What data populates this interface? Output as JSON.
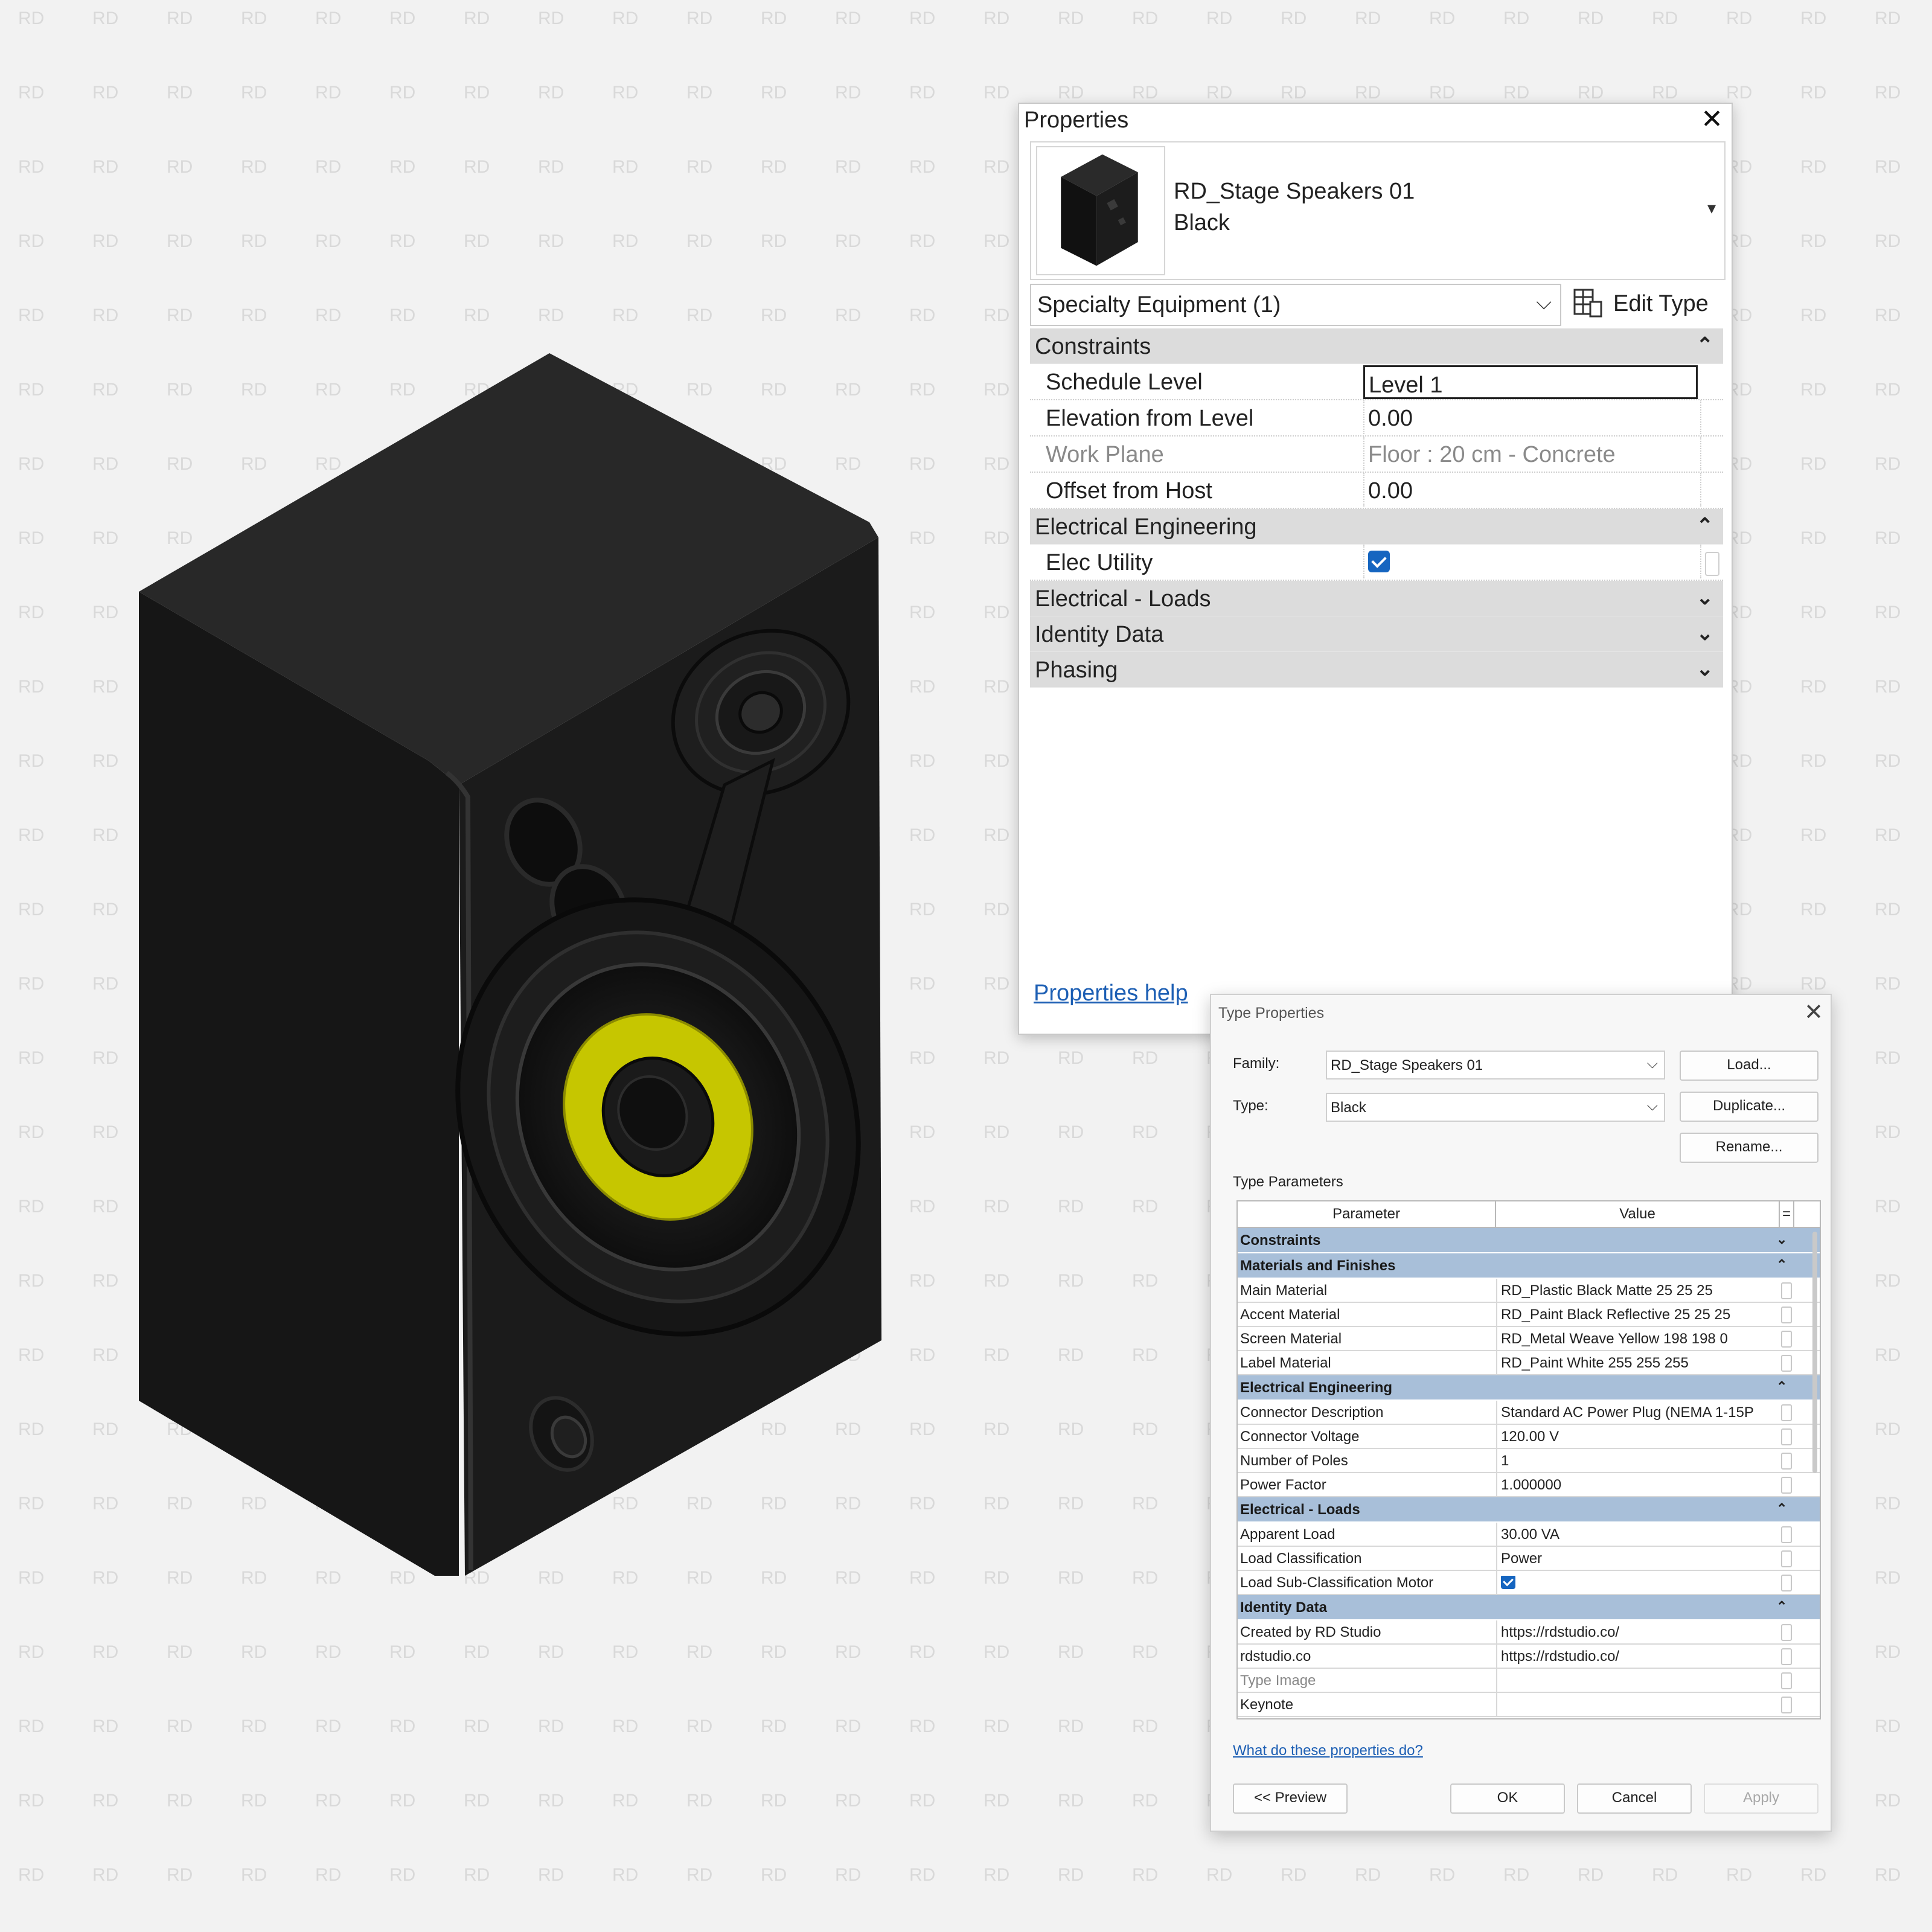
{
  "watermark": {
    "text": "RD",
    "color": "#d9d9d9"
  },
  "properties": {
    "title": "Properties",
    "close_glyph": "✕",
    "type_selector": {
      "family": "RD_Stage Speakers 01",
      "type": "Black",
      "arrow_glyph": "▾"
    },
    "category_dropdown": "Specialty Equipment (1)",
    "edit_type_label": "Edit Type",
    "groups": [
      {
        "label": "Constraints",
        "expanded": true,
        "rows": [
          {
            "name": "Schedule Level",
            "value": "Level 1",
            "editing": true
          },
          {
            "name": "Elevation from Level",
            "value": "0.00"
          },
          {
            "name": "Work Plane",
            "value": "Floor : 20 cm - Concrete",
            "readonly": true
          },
          {
            "name": "Offset from Host",
            "value": "0.00"
          }
        ]
      },
      {
        "label": "Electrical Engineering",
        "expanded": true,
        "rows": [
          {
            "name": "Elec Utility",
            "checked": true
          }
        ]
      },
      {
        "label": "Electrical - Loads",
        "expanded": false
      },
      {
        "label": "Identity Data",
        "expanded": false
      },
      {
        "label": "Phasing",
        "expanded": false
      }
    ],
    "help_link": "Properties help",
    "glyphs": {
      "collapse": "⌃",
      "expand": "⌄"
    }
  },
  "type_properties": {
    "title": "Type Properties",
    "close_glyph": "✕",
    "family_label": "Family:",
    "family_value": "RD_Stage Speakers 01",
    "type_label": "Type:",
    "type_value": "Black",
    "buttons": {
      "load": "Load...",
      "duplicate": "Duplicate...",
      "rename": "Rename..."
    },
    "type_parameters_label": "Type Parameters",
    "columns": {
      "parameter": "Parameter",
      "value": "Value",
      "eq": "="
    },
    "groups": [
      {
        "label": "Constraints",
        "expanded": false,
        "rows": []
      },
      {
        "label": "Materials and Finishes",
        "expanded": true,
        "rows": [
          {
            "name": "Main Material",
            "value": "RD_Plastic Black Matte 25 25 25"
          },
          {
            "name": "Accent Material",
            "value": "RD_Paint Black Reflective 25 25 25"
          },
          {
            "name": "Screen Material",
            "value": "RD_Metal Weave Yellow 198 198 0"
          },
          {
            "name": "Label Material",
            "value": "RD_Paint White 255 255 255"
          }
        ]
      },
      {
        "label": "Electrical Engineering",
        "expanded": true,
        "rows": [
          {
            "name": "Connector Description",
            "value": "Standard AC Power Plug (NEMA 1-15P"
          },
          {
            "name": "Connector Voltage",
            "value": "120.00 V"
          },
          {
            "name": "Number of Poles",
            "value": "1"
          },
          {
            "name": "Power Factor",
            "value": "1.000000"
          }
        ]
      },
      {
        "label": "Electrical - Loads",
        "expanded": true,
        "rows": [
          {
            "name": "Apparent Load",
            "value": "30.00 VA"
          },
          {
            "name": "Load Classification",
            "value": "Power"
          },
          {
            "name": "Load Sub-Classification Motor",
            "checked": true
          }
        ]
      },
      {
        "label": "Identity Data",
        "expanded": true,
        "rows": [
          {
            "name": "Created by RD Studio",
            "value": "https://rdstudio.co/"
          },
          {
            "name": "rdstudio.co",
            "value": "https://rdstudio.co/"
          },
          {
            "name": "Type Image",
            "value": "",
            "readonly": true
          },
          {
            "name": "Keynote",
            "value": ""
          }
        ]
      }
    ],
    "help_link": "What do these properties do?",
    "footer_buttons": {
      "preview": "<< Preview",
      "ok": "OK",
      "cancel": "Cancel",
      "apply": "Apply"
    },
    "glyphs": {
      "collapse": "⌃",
      "expand": "⌄",
      "dropdown": "⌵"
    }
  },
  "colors": {
    "speaker_body": "#1c1c1c",
    "speaker_screen": "#c6c600",
    "group_header": "#a8bfd9",
    "checkbox": "#1565c0",
    "link": "#1d5fb4"
  }
}
